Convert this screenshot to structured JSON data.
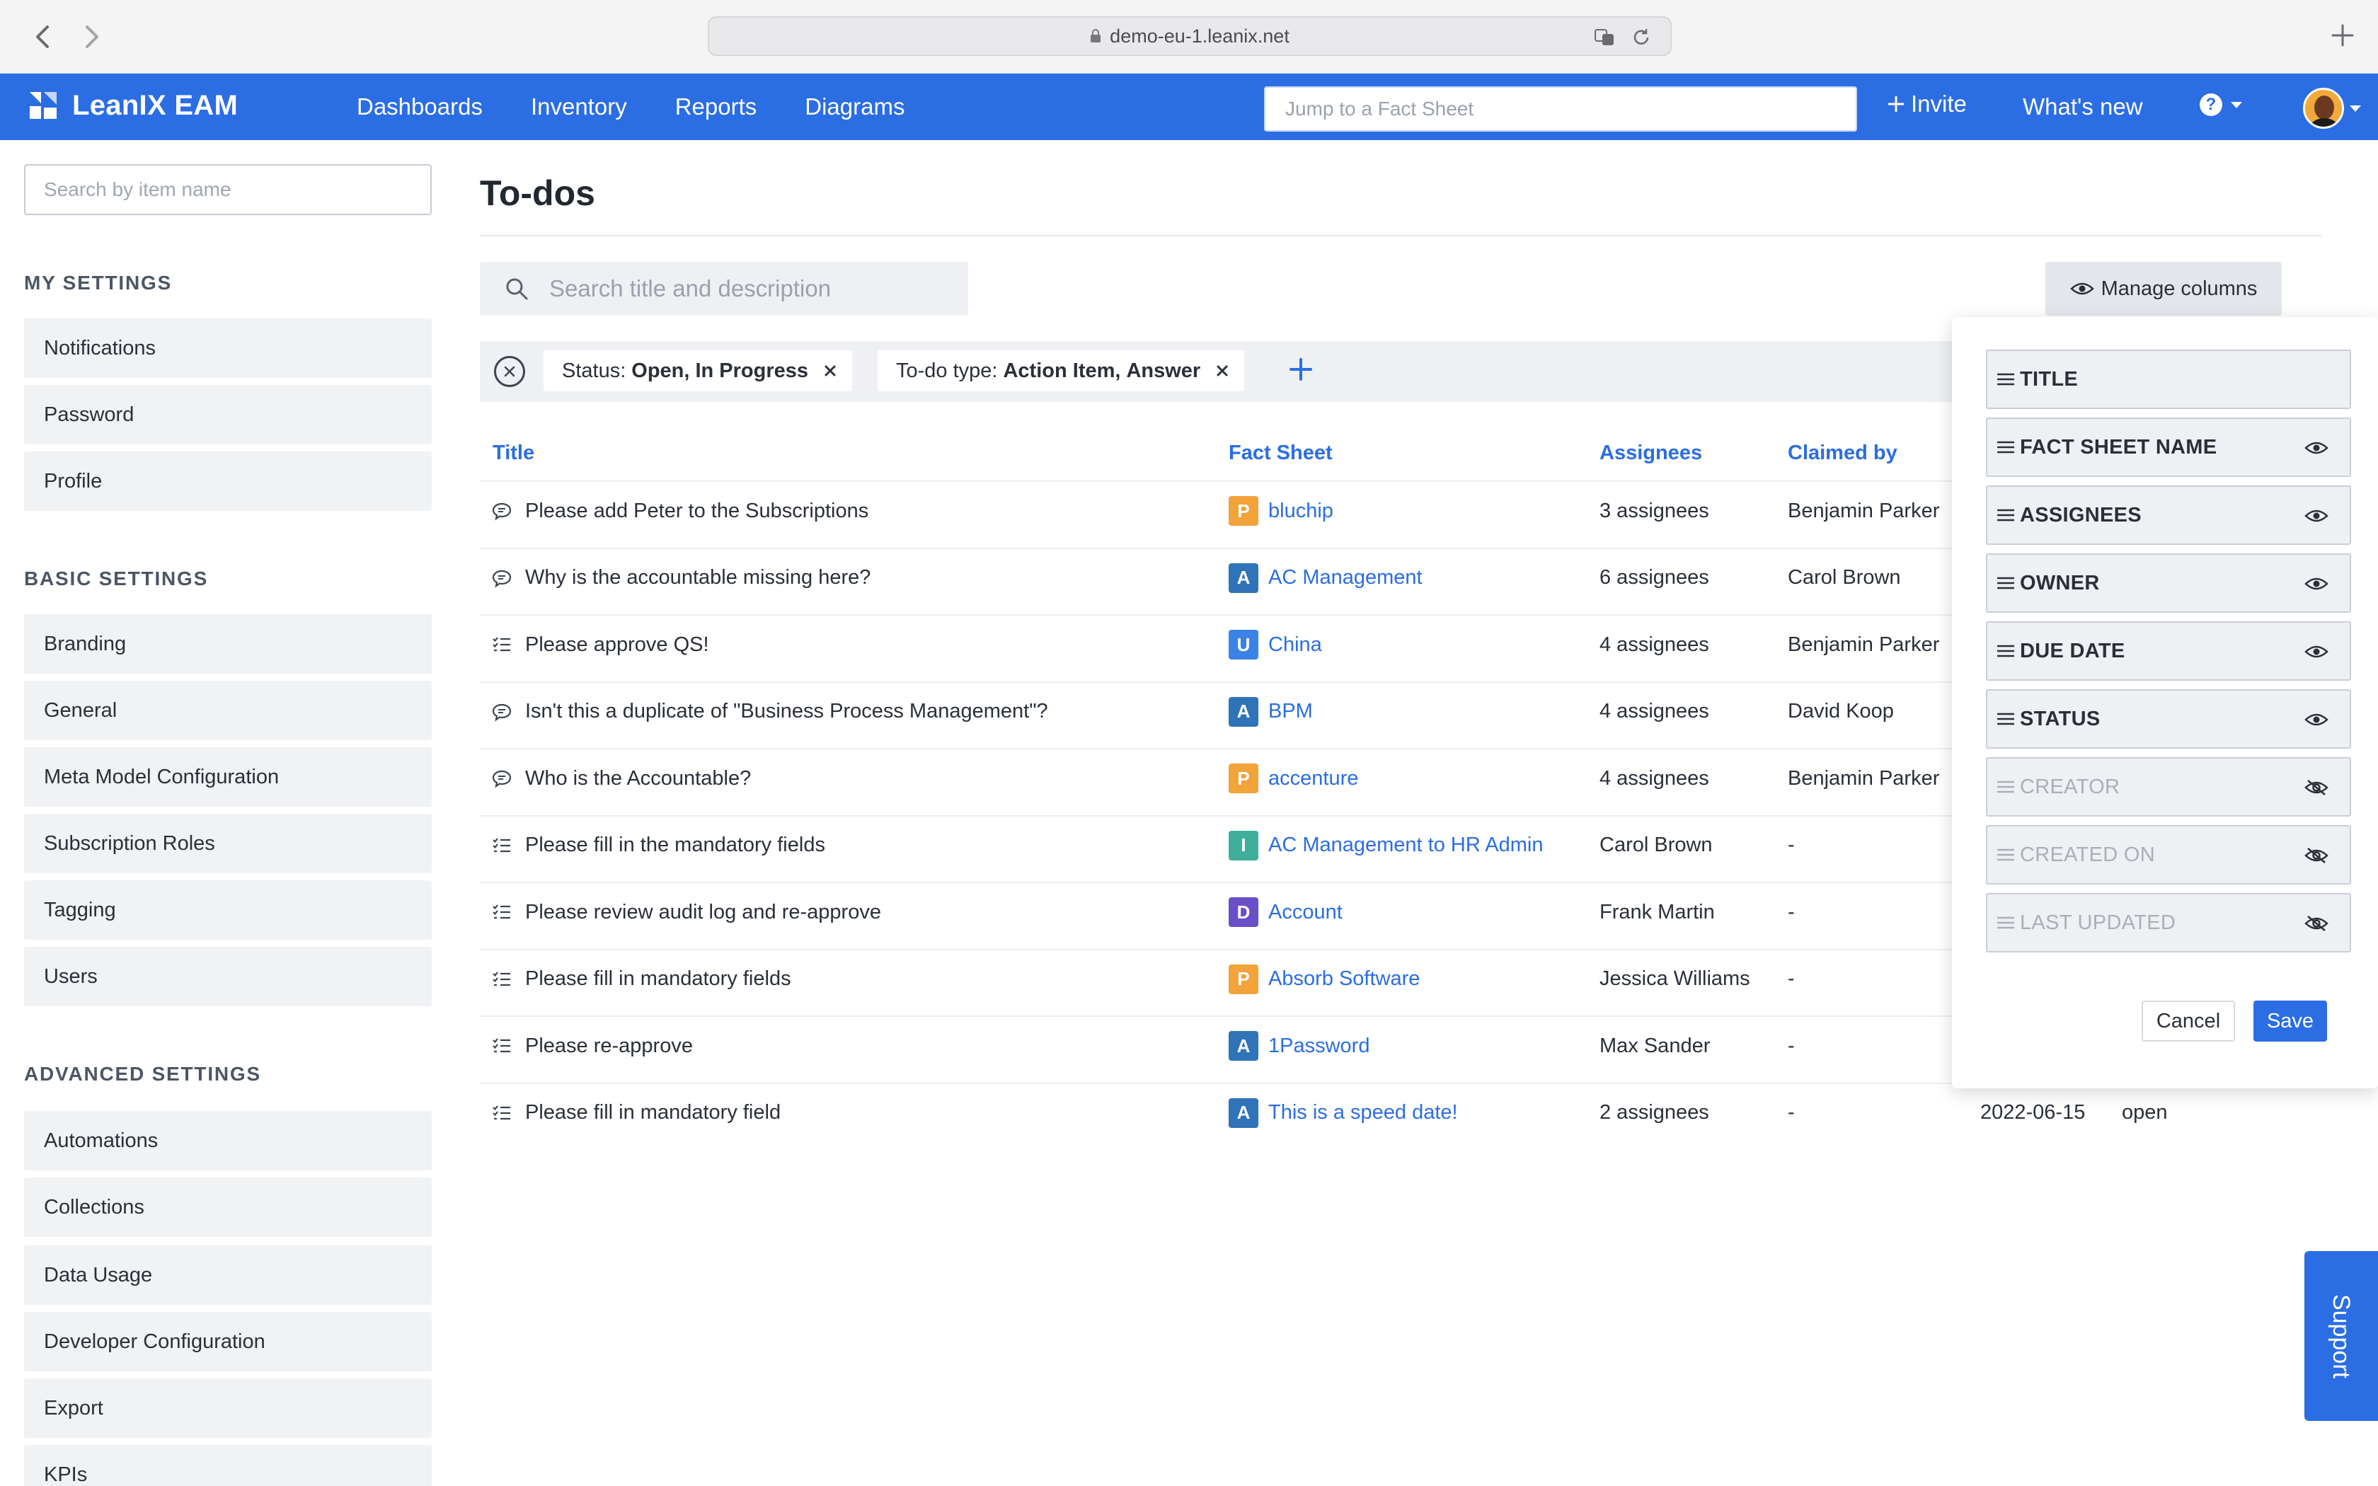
{
  "browser": {
    "url": "demo-eu-1.leanix.net"
  },
  "header": {
    "logo_text": "LeanIX EAM",
    "nav": [
      "Dashboards",
      "Inventory",
      "Reports",
      "Diagrams"
    ],
    "jump_placeholder": "Jump to a Fact Sheet",
    "invite_label": "Invite",
    "whats_new_label": "What's new"
  },
  "sidebar": {
    "search_placeholder": "Search by item name",
    "sections": [
      {
        "title": "MY SETTINGS",
        "items": [
          "Notifications",
          "Password",
          "Profile"
        ]
      },
      {
        "title": "BASIC SETTINGS",
        "items": [
          "Branding",
          "General",
          "Meta Model Configuration",
          "Subscription Roles",
          "Tagging",
          "Users"
        ]
      },
      {
        "title": "ADVANCED SETTINGS",
        "items": [
          "Automations",
          "Collections",
          "Data Usage",
          "Developer Configuration",
          "Export",
          "KPIs"
        ]
      }
    ]
  },
  "main": {
    "title": "To-dos",
    "search_placeholder": "Search title and description",
    "manage_columns_label": "Manage columns",
    "filters": [
      {
        "label": "Status:",
        "values": [
          "Open,",
          "In Progress"
        ]
      },
      {
        "label": "To-do type:",
        "values": [
          "Action Item,",
          "Answer"
        ]
      }
    ],
    "columns": [
      "Title",
      "Fact Sheet",
      "Assignees",
      "Claimed by"
    ],
    "rows": [
      {
        "icon": "comment",
        "title": "Please add Peter to the Subscriptions",
        "badge": "P",
        "badge_color": "#f2a33a",
        "fact_sheet": "bluchip",
        "assignees": "3 assignees",
        "claimed_by": "Benjamin Parker",
        "due": "",
        "status": ""
      },
      {
        "icon": "comment",
        "title": "Why is the accountable missing here?",
        "badge": "A",
        "badge_color": "#2f73b8",
        "fact_sheet": "AC Management",
        "assignees": "6 assignees",
        "claimed_by": "Carol Brown",
        "due": "",
        "status": ""
      },
      {
        "icon": "checklist",
        "title": "Please approve QS!",
        "badge": "U",
        "badge_color": "#3b82e6",
        "fact_sheet": "China",
        "assignees": "4 assignees",
        "claimed_by": "Benjamin Parker",
        "due": "",
        "status": ""
      },
      {
        "icon": "comment",
        "title": "Isn't this a duplicate of \"Business Process Management\"?",
        "badge": "A",
        "badge_color": "#2f73b8",
        "fact_sheet": "BPM",
        "assignees": "4 assignees",
        "claimed_by": "David Koop",
        "due": "",
        "status": ""
      },
      {
        "icon": "comment",
        "title": "Who is the Accountable?",
        "badge": "P",
        "badge_color": "#f2a33a",
        "fact_sheet": "accenture",
        "assignees": "4 assignees",
        "claimed_by": "Benjamin Parker",
        "due": "",
        "status": ""
      },
      {
        "icon": "checklist",
        "title": "Please fill in the mandatory fields",
        "badge": "I",
        "badge_color": "#3fae9b",
        "fact_sheet": "AC Management to HR Admin",
        "assignees": "Carol Brown",
        "claimed_by": "-",
        "due": "",
        "status": ""
      },
      {
        "icon": "checklist",
        "title": "Please review audit log and re-approve",
        "badge": "D",
        "badge_color": "#6b4fc8",
        "fact_sheet": "Account",
        "assignees": "Frank Martin",
        "claimed_by": "-",
        "due": "",
        "status": ""
      },
      {
        "icon": "checklist",
        "title": "Please fill in mandatory fields",
        "badge": "P",
        "badge_color": "#f2a33a",
        "fact_sheet": "Absorb Software",
        "assignees": "Jessica Williams",
        "claimed_by": "-",
        "due": "",
        "status": ""
      },
      {
        "icon": "checklist",
        "title": "Please re-approve",
        "badge": "A",
        "badge_color": "#2f73b8",
        "fact_sheet": "1Password",
        "assignees": "Max Sander",
        "claimed_by": "-",
        "due": "",
        "status": ""
      },
      {
        "icon": "checklist",
        "title": "Please fill in mandatory field",
        "badge": "A",
        "badge_color": "#2f73b8",
        "fact_sheet": "This is a speed date!",
        "assignees": "2 assignees",
        "claimed_by": "-",
        "due": "2022-06-15",
        "status": "open"
      }
    ]
  },
  "column_panel": {
    "items": [
      {
        "label": "TITLE",
        "visible": true,
        "toggle": false
      },
      {
        "label": "FACT SHEET NAME",
        "visible": true,
        "toggle": true
      },
      {
        "label": "ASSIGNEES",
        "visible": true,
        "toggle": true
      },
      {
        "label": "OWNER",
        "visible": true,
        "toggle": true
      },
      {
        "label": "DUE DATE",
        "visible": true,
        "toggle": true
      },
      {
        "label": "STATUS",
        "visible": true,
        "toggle": true
      },
      {
        "label": "CREATOR",
        "visible": false,
        "toggle": true
      },
      {
        "label": "CREATED ON",
        "visible": false,
        "toggle": true
      },
      {
        "label": "LAST UPDATED",
        "visible": false,
        "toggle": true
      }
    ],
    "cancel_label": "Cancel",
    "save_label": "Save"
  },
  "support_label": "Support",
  "colors": {
    "brand": "#2b6de3",
    "panel_bg": "#eef0f3"
  }
}
